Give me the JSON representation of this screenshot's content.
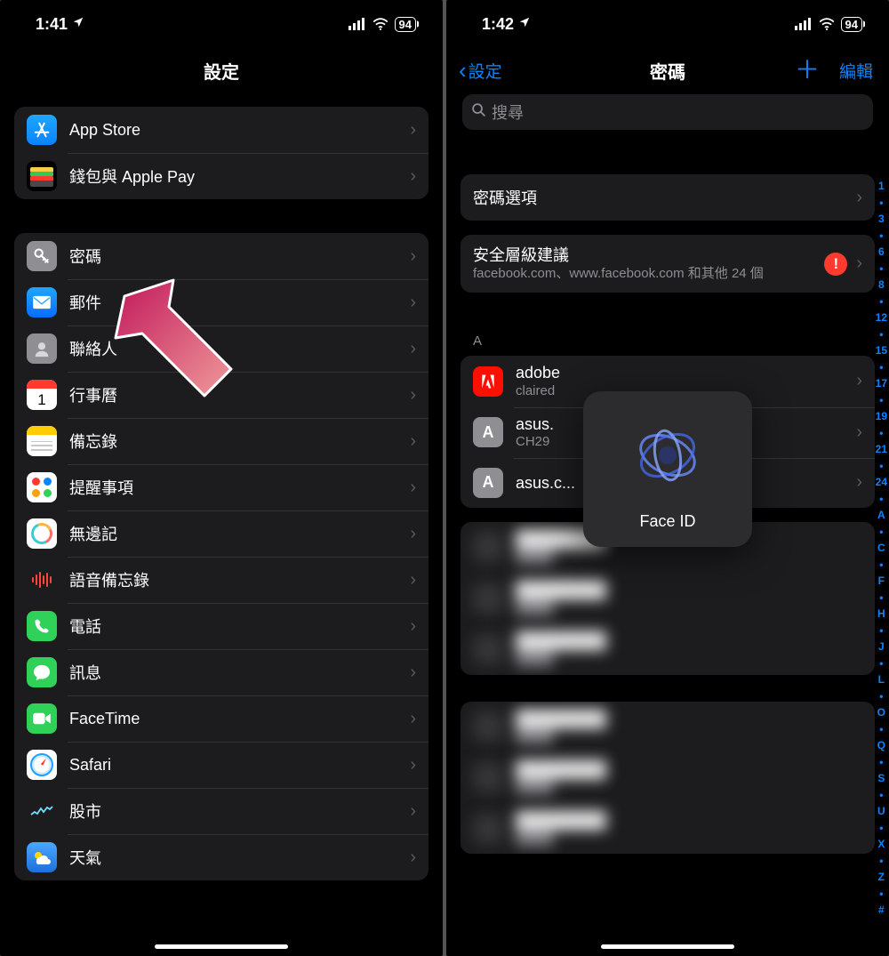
{
  "left": {
    "status": {
      "time": "1:41",
      "battery": "94"
    },
    "title": "設定",
    "group1": [
      {
        "name": "app-store",
        "label": "App Store"
      },
      {
        "name": "wallet",
        "label": "錢包與 Apple Pay"
      }
    ],
    "group2": [
      {
        "name": "passwords",
        "label": "密碼"
      },
      {
        "name": "mail",
        "label": "郵件"
      },
      {
        "name": "contacts",
        "label": "聯絡人"
      },
      {
        "name": "calendar",
        "label": "行事曆"
      },
      {
        "name": "notes",
        "label": "備忘錄"
      },
      {
        "name": "reminders",
        "label": "提醒事項"
      },
      {
        "name": "freeform",
        "label": "無邊記"
      },
      {
        "name": "voice-memos",
        "label": "語音備忘錄"
      },
      {
        "name": "phone",
        "label": "電話"
      },
      {
        "name": "messages",
        "label": "訊息"
      },
      {
        "name": "facetime",
        "label": "FaceTime"
      },
      {
        "name": "safari",
        "label": "Safari"
      },
      {
        "name": "stocks",
        "label": "股市"
      },
      {
        "name": "weather",
        "label": "天氣"
      }
    ]
  },
  "right": {
    "status": {
      "time": "1:42",
      "battery": "94"
    },
    "back_label": "設定",
    "title": "密碼",
    "edit_label": "編輯",
    "search_placeholder": "搜尋",
    "options_row": "密碼選項",
    "security": {
      "title": "安全層級建議",
      "subtitle": "facebook.com、www.facebook.com 和其他 24 個",
      "badge": "!"
    },
    "section_a": "A",
    "accounts": [
      {
        "title": "adobe",
        "sub": "claired",
        "icon": "adobe"
      },
      {
        "title": "asus.",
        "sub": "CH29",
        "icon": "A"
      },
      {
        "title": "asus.c...",
        "sub": "",
        "icon": "A"
      }
    ],
    "faceid_label": "Face ID",
    "index_strip": [
      "1",
      "•",
      "3",
      "•",
      "6",
      "•",
      "8",
      "•",
      "12",
      "•",
      "15",
      "•",
      "17",
      "•",
      "19",
      "•",
      "21",
      "•",
      "24",
      "•",
      "A",
      "•",
      "C",
      "•",
      "F",
      "•",
      "H",
      "•",
      "J",
      "•",
      "L",
      "•",
      "O",
      "•",
      "Q",
      "•",
      "S",
      "•",
      "U",
      "•",
      "X",
      "•",
      "Z",
      "•",
      "#"
    ]
  }
}
